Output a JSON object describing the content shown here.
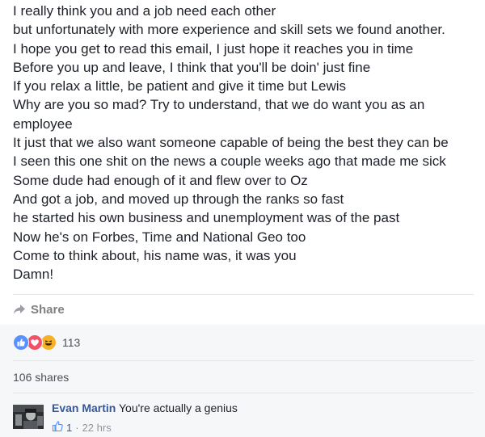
{
  "post": {
    "lines": [
      "I really think you and a job need each other",
      "but unfortunately with more experience and skill sets we found another.",
      "I hope you get to read this email, I just hope it reaches you in time",
      "Before you up and leave, I think that you'll be doin' just fine",
      "If you relax a little, be patient and give it time but Lewis",
      "Why are you so mad? Try to understand, that we do want you as an",
      "employee",
      "It just that we also want someone capable of being the best they can be",
      "I seen this one shit on the news a couple weeks ago that made me sick",
      "Some dude had enough of it and flew over to Oz",
      "And got a job, and moved up through the ranks so fast",
      "he started his own business and unemployment was of the past",
      "Now he's on Forbes, Time and National Geo too",
      "Come to think about, his name was, it was you",
      "Damn!"
    ]
  },
  "actions": {
    "share_label": "Share",
    "share_icon": "share-arrow-icon"
  },
  "reactions": {
    "icons": [
      "like-reaction-icon",
      "love-reaction-icon",
      "haha-reaction-icon"
    ],
    "count": "113",
    "colors": {
      "like": "#5890ff",
      "love": "#f25268",
      "haha": "#f7b125"
    }
  },
  "shares": {
    "label": "106 shares"
  },
  "comment": {
    "author": "Evan Martin",
    "text": "You're actually a genius",
    "like_count": "1",
    "separator": "·",
    "time": "22 hrs"
  },
  "colors": {
    "text": "#1d2129",
    "link": "#365899",
    "muted": "#90949c",
    "footer_bg": "#f6f7f9"
  }
}
